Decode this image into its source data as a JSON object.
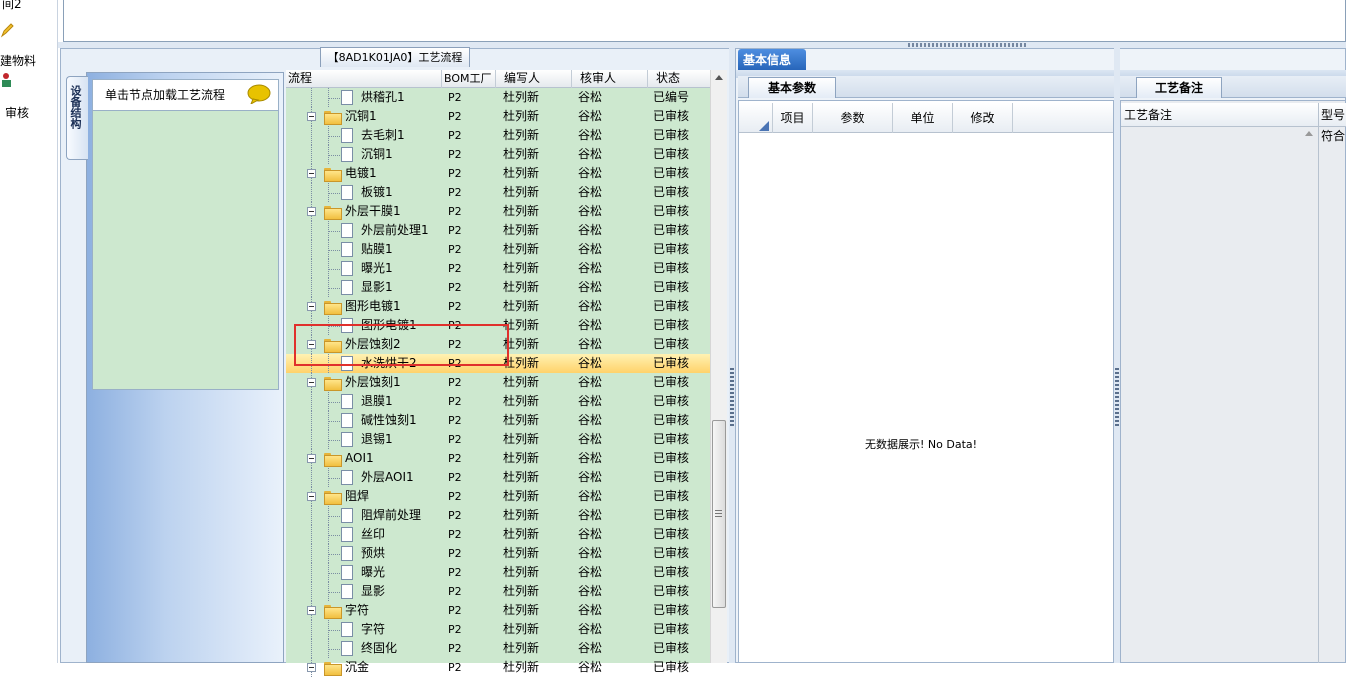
{
  "left_strip": {
    "item1_label": "间2",
    "item2_label": "建物料",
    "item3_label": "审核"
  },
  "process_panel": {
    "title": "【8AD1K01JA0】工艺流程",
    "vertical_tab": "设备结构",
    "hint": "单击节点加载工艺流程",
    "columns": [
      "流程",
      "BOM工厂",
      "编写人",
      "核审人",
      "状态"
    ],
    "rows": [
      {
        "name": "烘稽孔1",
        "bom": "P2",
        "writer": "杜列新",
        "reviewer": "谷松",
        "status": "已编号",
        "level": 2,
        "type": "page"
      },
      {
        "name": "沉铜1",
        "bom": "P2",
        "writer": "杜列新",
        "reviewer": "谷松",
        "status": "已审核",
        "level": 1,
        "type": "folder"
      },
      {
        "name": "去毛刺1",
        "bom": "P2",
        "writer": "杜列新",
        "reviewer": "谷松",
        "status": "已审核",
        "level": 2,
        "type": "page"
      },
      {
        "name": "沉铜1",
        "bom": "P2",
        "writer": "杜列新",
        "reviewer": "谷松",
        "status": "已审核",
        "level": 2,
        "type": "page"
      },
      {
        "name": "电镀1",
        "bom": "P2",
        "writer": "杜列新",
        "reviewer": "谷松",
        "status": "已审核",
        "level": 1,
        "type": "folder"
      },
      {
        "name": "板镀1",
        "bom": "P2",
        "writer": "杜列新",
        "reviewer": "谷松",
        "status": "已审核",
        "level": 2,
        "type": "page"
      },
      {
        "name": "外层干膜1",
        "bom": "P2",
        "writer": "杜列新",
        "reviewer": "谷松",
        "status": "已审核",
        "level": 1,
        "type": "folder"
      },
      {
        "name": "外层前处理1",
        "bom": "P2",
        "writer": "杜列新",
        "reviewer": "谷松",
        "status": "已审核",
        "level": 2,
        "type": "page"
      },
      {
        "name": "贴膜1",
        "bom": "P2",
        "writer": "杜列新",
        "reviewer": "谷松",
        "status": "已审核",
        "level": 2,
        "type": "page"
      },
      {
        "name": "曝光1",
        "bom": "P2",
        "writer": "杜列新",
        "reviewer": "谷松",
        "status": "已审核",
        "level": 2,
        "type": "page"
      },
      {
        "name": "显影1",
        "bom": "P2",
        "writer": "杜列新",
        "reviewer": "谷松",
        "status": "已审核",
        "level": 2,
        "type": "page"
      },
      {
        "name": "图形电镀1",
        "bom": "P2",
        "writer": "杜列新",
        "reviewer": "谷松",
        "status": "已审核",
        "level": 1,
        "type": "folder"
      },
      {
        "name": "图形电镀1",
        "bom": "P2",
        "writer": "杜列新",
        "reviewer": "谷松",
        "status": "已审核",
        "level": 2,
        "type": "page"
      },
      {
        "name": "外层蚀刻2",
        "bom": "P2",
        "writer": "杜列新",
        "reviewer": "谷松",
        "status": "已审核",
        "level": 1,
        "type": "folder"
      },
      {
        "name": "水洗烘干2",
        "bom": "P2",
        "writer": "杜列新",
        "reviewer": "谷松",
        "status": "已审核",
        "level": 2,
        "type": "page",
        "selected": true
      },
      {
        "name": "外层蚀刻1",
        "bom": "P2",
        "writer": "杜列新",
        "reviewer": "谷松",
        "status": "已审核",
        "level": 1,
        "type": "folder"
      },
      {
        "name": "退膜1",
        "bom": "P2",
        "writer": "杜列新",
        "reviewer": "谷松",
        "status": "已审核",
        "level": 2,
        "type": "page"
      },
      {
        "name": "碱性蚀刻1",
        "bom": "P2",
        "writer": "杜列新",
        "reviewer": "谷松",
        "status": "已审核",
        "level": 2,
        "type": "page"
      },
      {
        "name": "退锡1",
        "bom": "P2",
        "writer": "杜列新",
        "reviewer": "谷松",
        "status": "已审核",
        "level": 2,
        "type": "page"
      },
      {
        "name": "AOI1",
        "bom": "P2",
        "writer": "杜列新",
        "reviewer": "谷松",
        "status": "已审核",
        "level": 1,
        "type": "folder"
      },
      {
        "name": "外层AOI1",
        "bom": "P2",
        "writer": "杜列新",
        "reviewer": "谷松",
        "status": "已审核",
        "level": 2,
        "type": "page"
      },
      {
        "name": "阻焊",
        "bom": "P2",
        "writer": "杜列新",
        "reviewer": "谷松",
        "status": "已审核",
        "level": 1,
        "type": "folder"
      },
      {
        "name": "阻焊前处理",
        "bom": "P2",
        "writer": "杜列新",
        "reviewer": "谷松",
        "status": "已审核",
        "level": 2,
        "type": "page"
      },
      {
        "name": "丝印",
        "bom": "P2",
        "writer": "杜列新",
        "reviewer": "谷松",
        "status": "已审核",
        "level": 2,
        "type": "page"
      },
      {
        "name": "预烘",
        "bom": "P2",
        "writer": "杜列新",
        "reviewer": "谷松",
        "status": "已审核",
        "level": 2,
        "type": "page"
      },
      {
        "name": "曝光",
        "bom": "P2",
        "writer": "杜列新",
        "reviewer": "谷松",
        "status": "已审核",
        "level": 2,
        "type": "page"
      },
      {
        "name": "显影",
        "bom": "P2",
        "writer": "杜列新",
        "reviewer": "谷松",
        "status": "已审核",
        "level": 2,
        "type": "page"
      },
      {
        "name": "字符",
        "bom": "P2",
        "writer": "杜列新",
        "reviewer": "谷松",
        "status": "已审核",
        "level": 1,
        "type": "folder"
      },
      {
        "name": "字符",
        "bom": "P2",
        "writer": "杜列新",
        "reviewer": "谷松",
        "status": "已审核",
        "level": 2,
        "type": "page"
      },
      {
        "name": "终固化",
        "bom": "P2",
        "writer": "杜列新",
        "reviewer": "谷松",
        "status": "已审核",
        "level": 2,
        "type": "page"
      },
      {
        "name": "沉金",
        "bom": "P2",
        "writer": "杜列新",
        "reviewer": "谷松",
        "status": "已审核",
        "level": 1,
        "type": "folder"
      }
    ]
  },
  "info_panel": {
    "tab": "基本信息",
    "params_tab": "基本参数",
    "params_columns": [
      "项目",
      "参数",
      "单位",
      "修改"
    ],
    "empty_text": "无数据展示! No Data!",
    "notes_tab": "工艺备注",
    "notes_columns": [
      "工艺备注",
      "型号"
    ],
    "notes_cell": "符合"
  },
  "colors": {
    "tree_bg": "#cde8cf",
    "selection": "#ffd26a",
    "highlight_box": "#e0302c",
    "tab_blue": "#2563b8"
  }
}
